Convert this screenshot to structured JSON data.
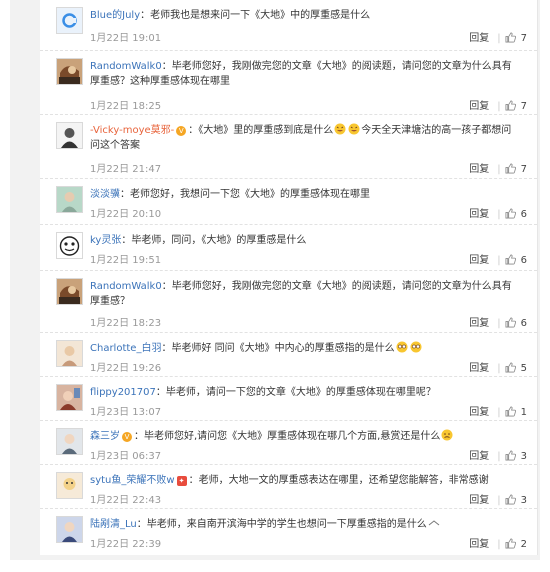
{
  "comments": [
    {
      "name": "Blue的July",
      "text": "：老师我也是想来问一下《大地》中的厚重感是什么",
      "time": "1月22日 19:01",
      "reply": "回复",
      "likes": "7"
    },
    {
      "name": "RandomWalk0",
      "text": "：毕老师您好，我刚做完您的文章《大地》的阅读题，请问您的文章为什么具有厚重感？这种厚重感体现在哪里",
      "time": "1月22日 18:25",
      "reply": "回复",
      "likes": "7"
    },
    {
      "name": "-Vicky-moye莫邪-",
      "text_a": "：《大地》里的厚重感到底是什么",
      "text_b": "今天全天津塘沽的高一孩子都想问问这个答案",
      "time": "1月22日 21:47",
      "reply": "回复",
      "likes": "7"
    },
    {
      "name": "淡淡骥",
      "text": "：老师您好，我想问一下您《大地》的厚重感体现在哪里",
      "time": "1月22日 20:10",
      "reply": "回复",
      "likes": "6"
    },
    {
      "name": "ky灵张",
      "text": "：毕老师，同问，《大地》的厚重感是什么",
      "time": "1月22日 19:51",
      "reply": "回复",
      "likes": "6"
    },
    {
      "name": "RandomWalk0",
      "text": "：毕老师您好，我刚做完您的文章《大地》的阅读题，请问您的文章为什么具有厚重感？",
      "time": "1月22日 18:23",
      "reply": "回复",
      "likes": "6"
    },
    {
      "name": "Charlotte_白羽",
      "text": "：毕老师好 同问《大地》中内心的厚重感指的是什么",
      "time": "1月22日 19:26",
      "reply": "回复",
      "likes": "5"
    },
    {
      "name": "flippy201707",
      "text": "：毕老师，请问一下您的文章《大地》的厚重感体现在哪里呢？",
      "time": "1月23日 13:07",
      "reply": "回复",
      "likes": "1"
    },
    {
      "name": "森三岁",
      "text": "：毕老师您好,请问您《大地》厚重感体现在哪几个方面,悬赏还是什么",
      "time": "1月23日 06:37",
      "reply": "回复",
      "likes": "3"
    },
    {
      "name": "sytu鱼_荣耀不败w",
      "text": "：老师，大地一文的厚重感表达在哪里，还希望您能解答，非常感谢",
      "time": "1月22日 22:43",
      "reply": "回复",
      "likes": "3"
    },
    {
      "name": "陆剐清_Lu",
      "text": "：毕老师，来自南开滨海中学的学生也想问一下厚重感指的是什么",
      "time": "1月22日 22:39",
      "reply": "回复",
      "likes": "2"
    }
  ],
  "colors": {
    "link": "#3b73b9",
    "meta": "#999999",
    "text": "#333333"
  },
  "icons": {
    "like": "thumbs-up-icon",
    "badge": "v-badge-icon",
    "emoji": "laughing-emoji-icon"
  }
}
